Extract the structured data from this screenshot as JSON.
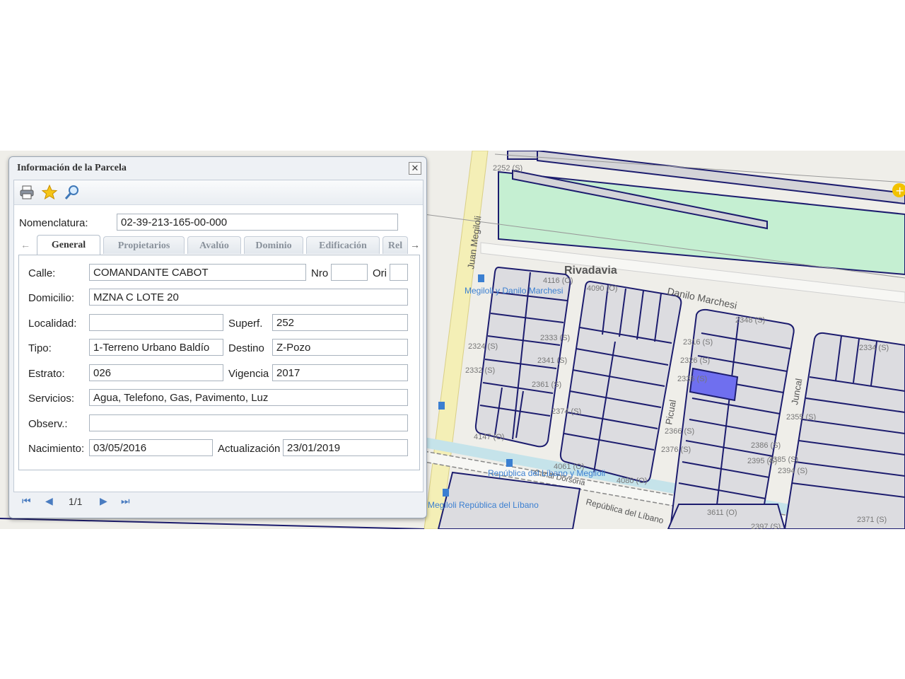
{
  "window": {
    "title": "Información de la Parcela",
    "close_label": "✕"
  },
  "toolbar": {
    "icons": [
      "print-icon",
      "star-icon",
      "search-icon"
    ]
  },
  "nomenclatura": {
    "label": "Nomenclatura:",
    "value": "02-39-213-165-00-000"
  },
  "tabs": [
    {
      "label": "General",
      "active": true
    },
    {
      "label": "Propietarios"
    },
    {
      "label": "Avalúo"
    },
    {
      "label": "Dominio"
    },
    {
      "label": "Edificación"
    },
    {
      "label": "Rel"
    }
  ],
  "form": {
    "calle": {
      "label": "Calle:",
      "value": "COMANDANTE CABOT"
    },
    "nro": {
      "label": "Nro",
      "value": ""
    },
    "ori": {
      "label": "Ori",
      "value": ""
    },
    "domicilio": {
      "label": "Domicilio:",
      "value": "MZNA C LOTE 20"
    },
    "localidad": {
      "label": "Localidad:",
      "value": ""
    },
    "superf": {
      "label": "Superf.",
      "value": "252"
    },
    "tipo": {
      "label": "Tipo:",
      "value": "1-Terreno Urbano Baldío"
    },
    "destino": {
      "label": "Destino",
      "value": "Z-Pozo"
    },
    "estrato": {
      "label": "Estrato:",
      "value": "026"
    },
    "vigencia": {
      "label": "Vigencia",
      "value": "2017"
    },
    "servicios": {
      "label": "Servicios:",
      "value": "Agua, Telefono, Gas, Pavimento, Luz"
    },
    "observ": {
      "label": "Observ.:",
      "value": ""
    },
    "nacimiento": {
      "label": "Nacimiento:",
      "value": "03/05/2016"
    },
    "actualizacion": {
      "label": "Actualización",
      "value": "23/01/2019"
    }
  },
  "pager": {
    "page": "1/1"
  },
  "map": {
    "streets": {
      "rivadavia": "Rivadavia",
      "danilo_marchesi": "Danilo Marchesi",
      "juan_megiloli": "Juan Megiloli",
      "picual": "Picual",
      "juncal": "Juncal",
      "canal": "Canal Dorsoria",
      "republica": "República del Líbano"
    },
    "stops": {
      "megiloli_danilo": "Megiloli y Danilo Marchesi",
      "republica_megiloli": "República del Líbano y Megiloli",
      "megiloli_republica": "Megiloli República del Líbano"
    },
    "parcel_labels": [
      "2252 (S)",
      "4116 (O)",
      "4090 (O)",
      "2348 (S)",
      "2333 (S)",
      "2324 (S)",
      "2341 (S)",
      "2332 (S)",
      "2361 (S)",
      "2374 (S)",
      "2316 (S)",
      "2326 (S)",
      "2336 (S)",
      "2366 (S)",
      "2376 (S)",
      "2386 (S)",
      "2334 (S)",
      "2355 (S)",
      "2385 (S)",
      "2395 (S)",
      "2394 (S)",
      "4147 (O)",
      "4061 (O)",
      "4080 (O)",
      "3611 (O)",
      "2371 (S)",
      "2397 (S)"
    ],
    "colors": {
      "parcel_fill": "#dcdce0",
      "parcel_stroke": "#1c1c6e",
      "park": "#c5efd2",
      "selected": "#6f6fef"
    }
  }
}
